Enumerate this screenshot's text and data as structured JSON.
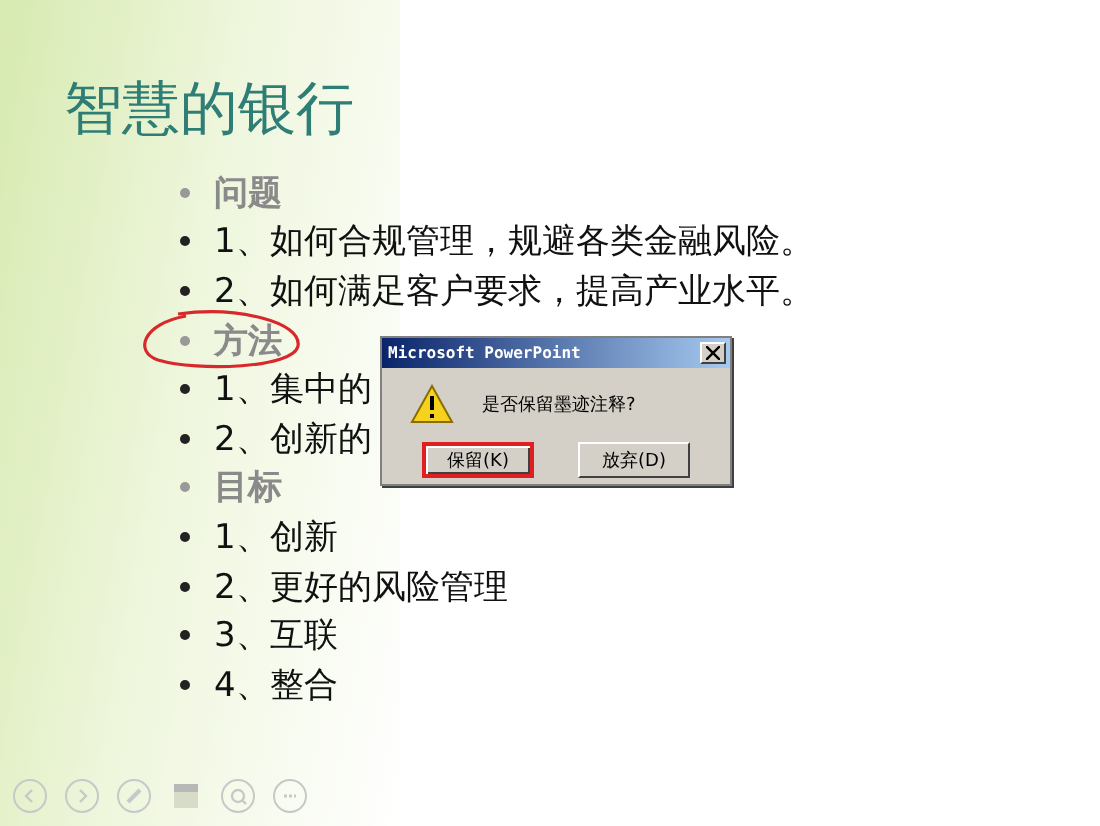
{
  "slide": {
    "title": "智慧的银行",
    "bullets": [
      {
        "kind": "header",
        "text": "问题",
        "circled": false
      },
      {
        "kind": "item",
        "text": "1、如何合规管理，规避各类金融风险。",
        "circled": false
      },
      {
        "kind": "item",
        "text": "2、如何满足客户要求，提高产业水平。",
        "circled": false
      },
      {
        "kind": "header",
        "text": "方法",
        "circled": true
      },
      {
        "kind": "item",
        "text": "1、集中的",
        "circled": false
      },
      {
        "kind": "item",
        "text": "2、创新的",
        "circled": false
      },
      {
        "kind": "header",
        "text": "目标",
        "circled": false
      },
      {
        "kind": "item",
        "text": "1、创新",
        "circled": false
      },
      {
        "kind": "item",
        "text": "2、更好的风险管理",
        "circled": false
      },
      {
        "kind": "item",
        "text": "3、互联",
        "circled": false
      },
      {
        "kind": "item",
        "text": "4、整合",
        "circled": false
      }
    ]
  },
  "dialog": {
    "title": "Microsoft PowerPoint",
    "message": "是否保留墨迹注释?",
    "buttons": [
      {
        "label": "保留(K)",
        "highlighted": true
      },
      {
        "label": "放弃(D)",
        "highlighted": false
      }
    ]
  }
}
